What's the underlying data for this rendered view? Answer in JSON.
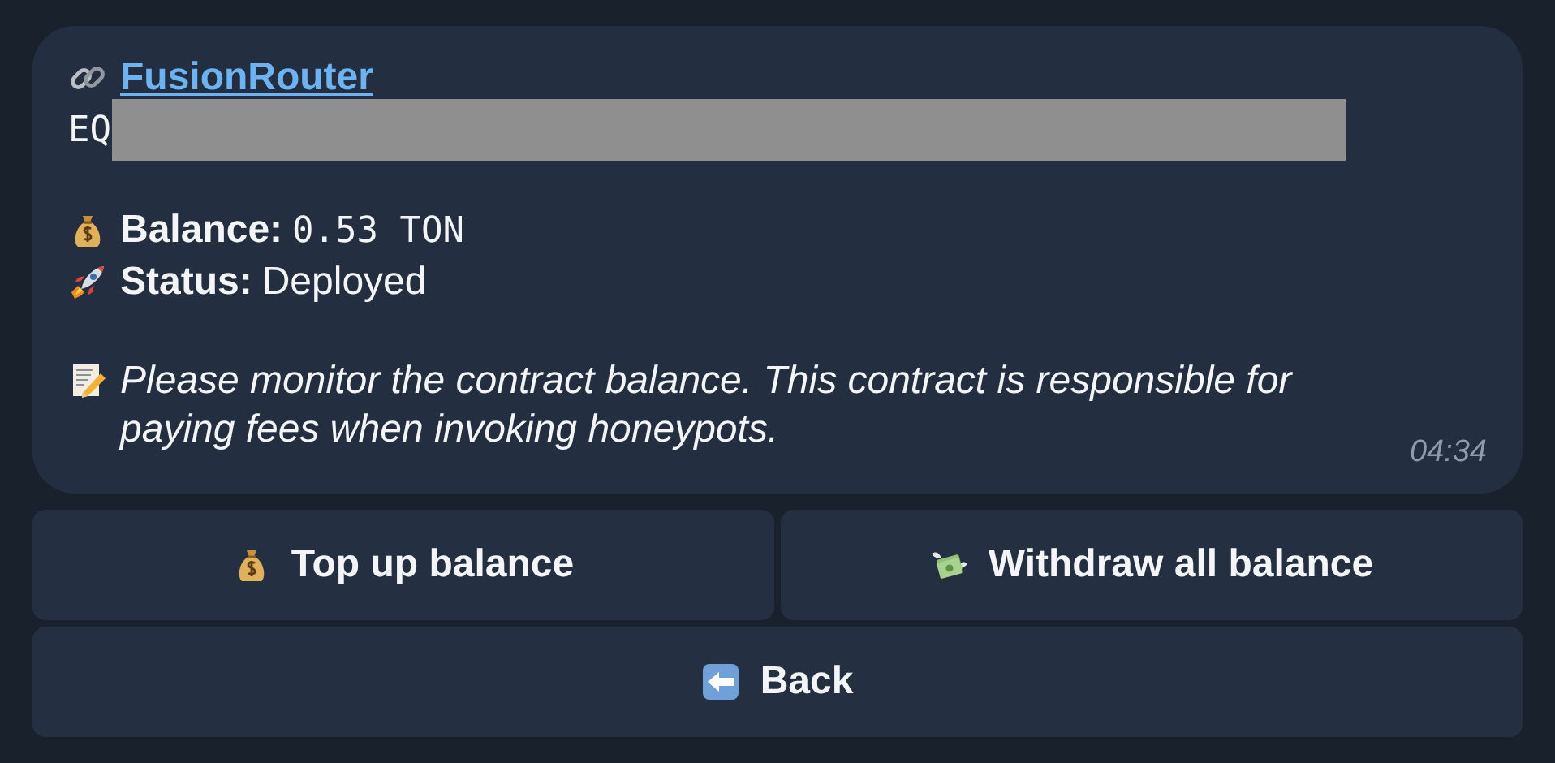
{
  "message": {
    "title": "FusionRouter",
    "address": "EQ",
    "fields": [
      {
        "kind": "balance",
        "label": "Balance:",
        "value": "0.53 TON"
      },
      {
        "kind": "status",
        "label": "Status:",
        "value": "Deployed"
      }
    ],
    "note": "Please monitor the contract balance. This contract is responsible for paying fees when invoking honeypots.",
    "time": "04:34"
  },
  "keyboard": [
    [
      {
        "kind": "top-up",
        "label": "Top up balance"
      },
      {
        "kind": "withdraw",
        "label": "Withdraw all balance"
      }
    ],
    [
      {
        "kind": "back",
        "label": "Back"
      }
    ]
  ]
}
